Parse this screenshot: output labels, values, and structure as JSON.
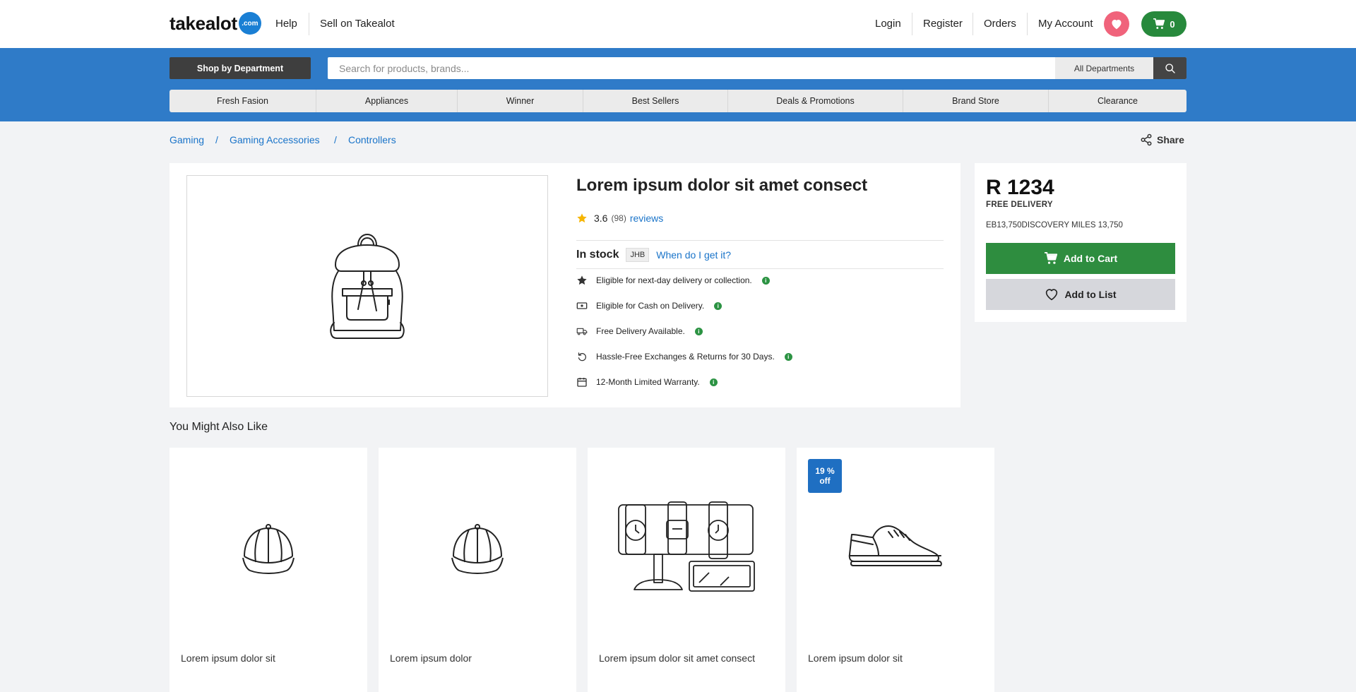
{
  "header": {
    "logo_text": "takealot",
    "logo_badge": ".com",
    "help": "Help",
    "sell": "Sell on Takealot",
    "login": "Login",
    "register": "Register",
    "orders": "Orders",
    "my_account": "My Account",
    "cart_count": "0"
  },
  "search": {
    "shop_by_department": "Shop by Department",
    "placeholder": "Search for products, brands...",
    "department_select": "All Departments"
  },
  "categories": [
    "Fresh Fasion",
    "Appliances",
    "Winner",
    "Best Sellers",
    "Deals & Promotions",
    "Brand Store",
    "Clearance"
  ],
  "breadcrumb": [
    "Gaming",
    "Gaming Accessories",
    "Controllers"
  ],
  "breadcrumb_separator": "/",
  "share_label": "Share",
  "product": {
    "title": "Lorem ipsum dolor sit amet consect",
    "rating": "3.6",
    "review_count": "(98)",
    "reviews_label": "reviews",
    "stock_status": "In stock",
    "warehouse": "JHB",
    "delivery_link": "When do I get it?",
    "features": [
      {
        "text": "Eligible for next-day delivery or collection.",
        "icon": "star-icon"
      },
      {
        "text": "Eligible for Cash on Delivery.",
        "icon": "cash-icon"
      },
      {
        "text": "Free Delivery Available.",
        "icon": "truck-icon"
      },
      {
        "text": "Hassle-Free Exchanges & Returns for 30 Days.",
        "icon": "return-icon"
      },
      {
        "text": "12-Month Limited Warranty.",
        "icon": "calendar-icon"
      }
    ],
    "image_icon": "backpack-illustration"
  },
  "buybox": {
    "price": "R 1234",
    "free_delivery": "FREE DELIVERY",
    "ebucks": "EB13,750DISCOVERY MILES 13,750",
    "add_to_cart": "Add to Cart",
    "add_to_list": "Add to List"
  },
  "recommendations": {
    "title": "You Might Also Like",
    "items": [
      {
        "label": "Lorem ipsum dolor sit",
        "image": "cap-illustration"
      },
      {
        "label": "Lorem ipsum dolor",
        "image": "cap-illustration"
      },
      {
        "label": "Lorem ipsum dolor sit amet consect",
        "image": "watches-illustration"
      },
      {
        "label": "Lorem ipsum dolor sit",
        "image": "sneaker-illustration",
        "badge_line1": "19 %",
        "badge_line2": "off"
      }
    ]
  },
  "colors": {
    "brand_blue": "#2f7bc8",
    "link_blue": "#1a74c9",
    "cart_green": "#2e8d3f",
    "wishlist_pink": "#f0637b",
    "badge_blue": "#1f6fc2"
  }
}
